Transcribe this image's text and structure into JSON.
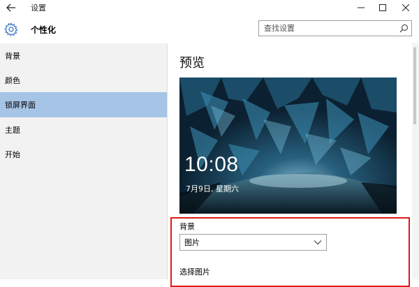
{
  "window": {
    "title": "设置"
  },
  "header": {
    "title": "个性化",
    "search_placeholder": "查找设置"
  },
  "sidebar": {
    "items": [
      {
        "label": "背景",
        "active": false
      },
      {
        "label": "颜色",
        "active": false
      },
      {
        "label": "锁屏界面",
        "active": true
      },
      {
        "label": "主题",
        "active": false
      },
      {
        "label": "开始",
        "active": false
      }
    ]
  },
  "main": {
    "preview_title": "预览",
    "lock_time": "10:08",
    "lock_date": "7月9日, 星期六",
    "background_label": "背景",
    "background_value": "图片",
    "choose_picture_label": "选择图片"
  },
  "colors": {
    "accent_selected": "#a6c4e6",
    "sidebar_bg": "#f2f2f2",
    "highlight_border": "#e01818"
  }
}
